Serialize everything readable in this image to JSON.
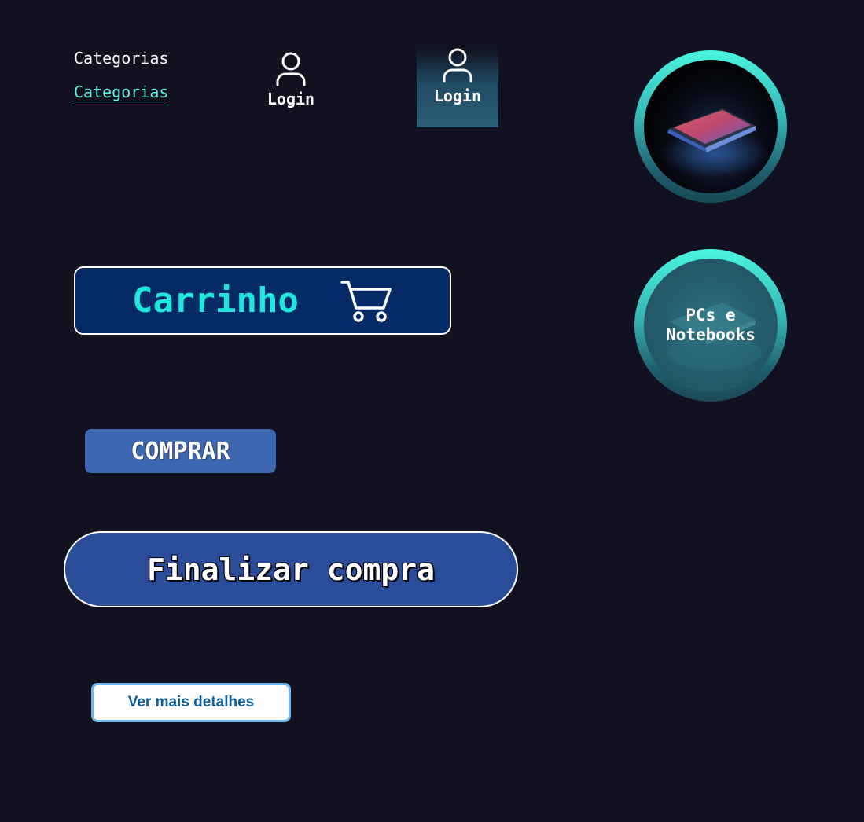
{
  "nav": {
    "categorias_default": "Categorias",
    "categorias_active": "Categorias"
  },
  "login_default": {
    "label": "Login",
    "icon": "user-icon"
  },
  "login_hover": {
    "label": "Login",
    "icon": "user-icon"
  },
  "category_cards": [
    {
      "image": "laptop-photo",
      "label": ""
    },
    {
      "image": "laptop-photo",
      "label": "PCs e Notebooks"
    }
  ],
  "cart": {
    "label": "Carrinho",
    "icon": "cart-icon"
  },
  "buy": {
    "label": "COMPRAR"
  },
  "finish": {
    "label": "Finalizar compra"
  },
  "details": {
    "label": "Ver mais detalhes"
  },
  "colors": {
    "background": "#11111f",
    "accent_cyan": "#1ee8de",
    "link_hover": "#5cf0e0",
    "cart_bg": "#052a66",
    "buy_bg": "#3e67b1",
    "finish_bg": "#2a4c99",
    "details_border": "#6bb8f2",
    "details_text": "#0e5e99"
  }
}
